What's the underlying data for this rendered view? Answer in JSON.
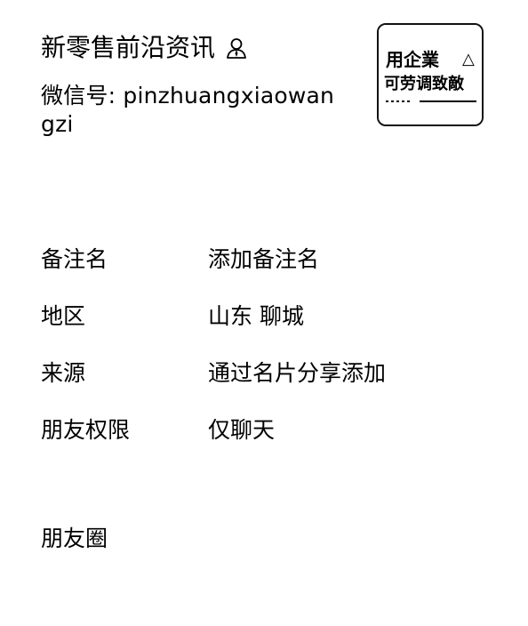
{
  "profile": {
    "name": "新零售前沿资讯",
    "wechat_id_prefix": "微信号:",
    "wechat_id": "pinzhuangxiaowangzi"
  },
  "avatar": {
    "logo_line1": "用企業",
    "logo_line2": "可劳调致敵",
    "logo_badge": "△"
  },
  "info": {
    "rows": [
      {
        "label": "备注名",
        "value": "添加备注名"
      },
      {
        "label": "地区",
        "value": "山东 聊城"
      },
      {
        "label": "来源",
        "value": "通过名片分享添加"
      },
      {
        "label": "朋友权限",
        "value": "仅聊天"
      }
    ]
  },
  "moments": {
    "label": "朋友圈"
  },
  "icons": {
    "name_icon": "person-icon"
  },
  "colors": {
    "text": "#000000",
    "background": "#ffffff"
  }
}
